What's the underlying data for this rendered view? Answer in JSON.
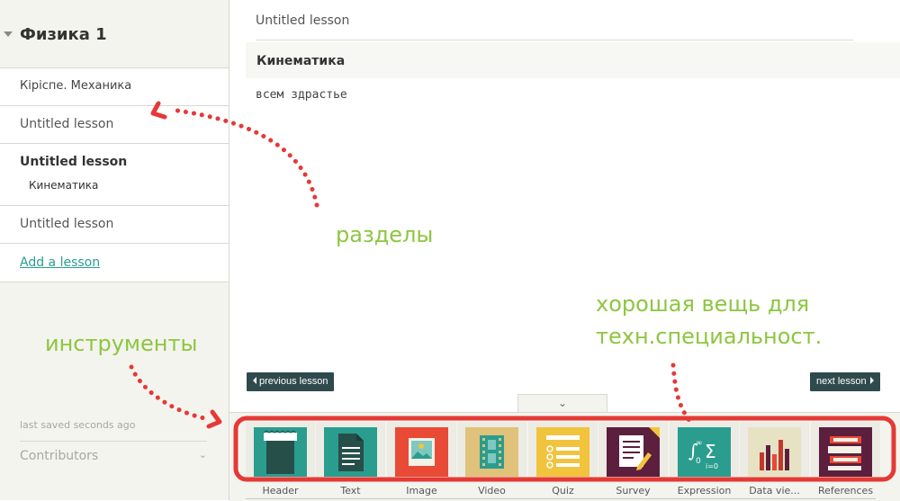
{
  "sidebar": {
    "course_title": "Физика 1",
    "lessons": [
      {
        "label": "Кіріспе. Механика"
      },
      {
        "label": "Untitled lesson"
      },
      {
        "label": "Untitled lesson",
        "sub": "Кинематика"
      },
      {
        "label": "Untitled lesson"
      }
    ],
    "add_lesson": "Add a lesson",
    "saved_status": "last saved seconds ago",
    "contributors": "Contributors"
  },
  "main": {
    "lesson_title": "Untitled lesson",
    "section_title": "Кинематика",
    "section_text": "всем здрастье",
    "prev_button": "previous lesson",
    "next_button": "next lesson",
    "collapse_glyph": "⌄"
  },
  "toolbar": {
    "tools": [
      {
        "label": "Header",
        "icon": "header-icon",
        "color": "#2a9d8f"
      },
      {
        "label": "Text",
        "icon": "text-icon",
        "color": "#2a9d8f"
      },
      {
        "label": "Image",
        "icon": "image-icon",
        "color": "#e84a36"
      },
      {
        "label": "Video",
        "icon": "video-icon",
        "color": "#e0c27a"
      },
      {
        "label": "Quiz",
        "icon": "quiz-icon",
        "color": "#f2c33c"
      },
      {
        "label": "Survey",
        "icon": "survey-icon",
        "color": "#5c1f3d"
      },
      {
        "label": "Expression",
        "icon": "expression-icon",
        "color": "#2a9d8f"
      },
      {
        "label": "Data vie...",
        "icon": "chart-icon",
        "color": "#e8e2c4"
      },
      {
        "label": "References",
        "icon": "references-icon",
        "color": "#5c1f3d"
      }
    ]
  },
  "annotations": {
    "sections": "разделы",
    "tools": "инструменты",
    "note_line1": "хорошая вещь для",
    "note_line2": "техн.специальност."
  },
  "colors": {
    "accent_teal": "#2a9d8f",
    "annotation_green": "#8dc63f",
    "annotation_red": "#e53935",
    "nav_button": "#2f4a4d"
  }
}
